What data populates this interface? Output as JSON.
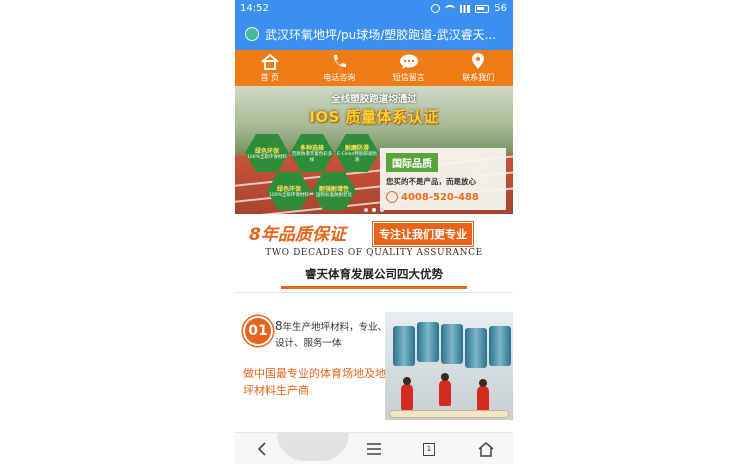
{
  "status_bar": {
    "time": "14:52",
    "battery": "56"
  },
  "address_bar": {
    "url": "武汉环氧地坪/pu球场/塑胶跑道-武汉睿天..."
  },
  "nav": [
    {
      "label": "首  页",
      "icon": "home-icon"
    },
    {
      "label": "电话咨询",
      "icon": "phone-icon"
    },
    {
      "label": "短信留言",
      "icon": "message-icon"
    },
    {
      "label": "联系我们",
      "icon": "location-icon"
    }
  ],
  "banner": {
    "headline": "全线塑胶跑道均通过",
    "cert": "IOS 质量体系认证",
    "hexes": [
      {
        "title": "绿色环保",
        "desc": "100%全新环保材料"
      },
      {
        "title": "多种选择",
        "desc": "百款防滑丰富色彩多样"
      },
      {
        "title": "耐磨防滑",
        "desc": "E-Clean特别研发防滑"
      },
      {
        "title": "绿色环保",
        "desc": "100%全新环保材料"
      },
      {
        "title": "耐强耐增性",
        "desc": "国际标准防耐老化"
      }
    ],
    "panel_title": "国际品质",
    "panel_slogan": "您买的不是产品，而是放心",
    "panel_phone": "4008-520-488"
  },
  "quality": {
    "big": "8年品质保证",
    "box": "专注让我们更专业",
    "english": "TWO DECADES OF QUALITY ASSURANCE",
    "title": "睿天体育发展公司四大优势"
  },
  "advantage": {
    "number": "01",
    "lead": "8",
    "text": "年生产地坪材料，专业、设计、服务一体",
    "slogan": "做中国最专业的体育场地及地坪材料生产商"
  },
  "bottom_bar": {
    "tab_count": "1"
  },
  "colors": {
    "brand_orange": "#f07c17",
    "chrome_blue": "#3b8ff0",
    "green": "#2f8c38"
  }
}
